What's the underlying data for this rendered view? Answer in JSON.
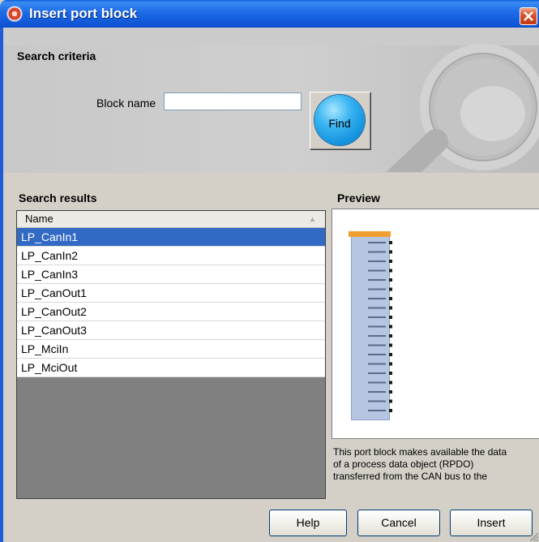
{
  "window": {
    "title": "Insert port block",
    "icon": "app-target-icon",
    "close_icon": "close-icon"
  },
  "search_criteria": {
    "heading": "Search criteria",
    "block_name_label": "Block name",
    "block_name_value": "",
    "find_label": "Find"
  },
  "search_results": {
    "heading": "Search results",
    "column_header": "Name",
    "selected_index": 0,
    "rows": [
      "LP_CanIn1",
      "LP_CanIn2",
      "LP_CanIn3",
      "LP_CanOut1",
      "LP_CanOut2",
      "LP_CanOut3",
      "LP_MciIn",
      "LP_MciOut"
    ]
  },
  "preview": {
    "heading": "Preview",
    "description_lines": [
      "This port block makes available the data",
      "of a process data object (RPDO)",
      "transferred from the CAN bus to the"
    ]
  },
  "buttons": {
    "help": "Help",
    "cancel": "Cancel",
    "insert": "Insert"
  },
  "colors": {
    "titlebar": "#1d6be6",
    "selection": "#316ac5",
    "find_button": "#1595e0",
    "close_button": "#d8512a"
  }
}
